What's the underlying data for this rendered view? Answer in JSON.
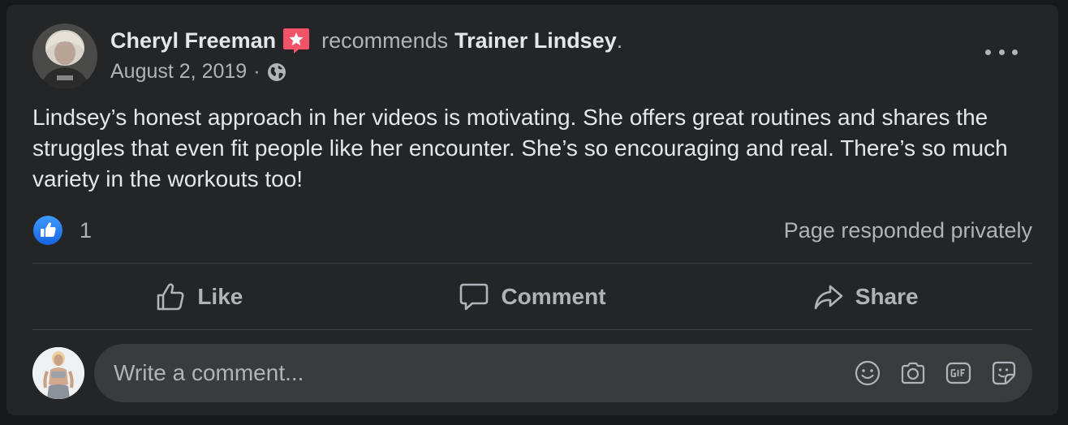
{
  "post": {
    "author": "Cheryl Freeman",
    "action": "recommends",
    "page": "Trainer Lindsey",
    "page_suffix": ".",
    "date": "August 2, 2019",
    "date_sep": "·",
    "privacy_icon": "globe-icon",
    "body": "Lindsey’s honest approach in her videos is motivating. She offers great routines and shares the struggles that even fit people like her encounter. She’s so encouraging and real. There’s so much variety in the workouts too!"
  },
  "stats": {
    "like_count": "1",
    "responded": "Page responded privately"
  },
  "actions": {
    "like": "Like",
    "comment": "Comment",
    "share": "Share"
  },
  "composer": {
    "placeholder": "Write a comment...",
    "tools": [
      "emoji-icon",
      "camera-icon",
      "gif-icon",
      "sticker-icon"
    ]
  },
  "colors": {
    "background": "#18191a",
    "card": "#242526",
    "primary_text": "#e4e6eb",
    "secondary_text": "#b0b3b8",
    "like_blue": "#1877f2",
    "recommend_red": "#f35369"
  }
}
